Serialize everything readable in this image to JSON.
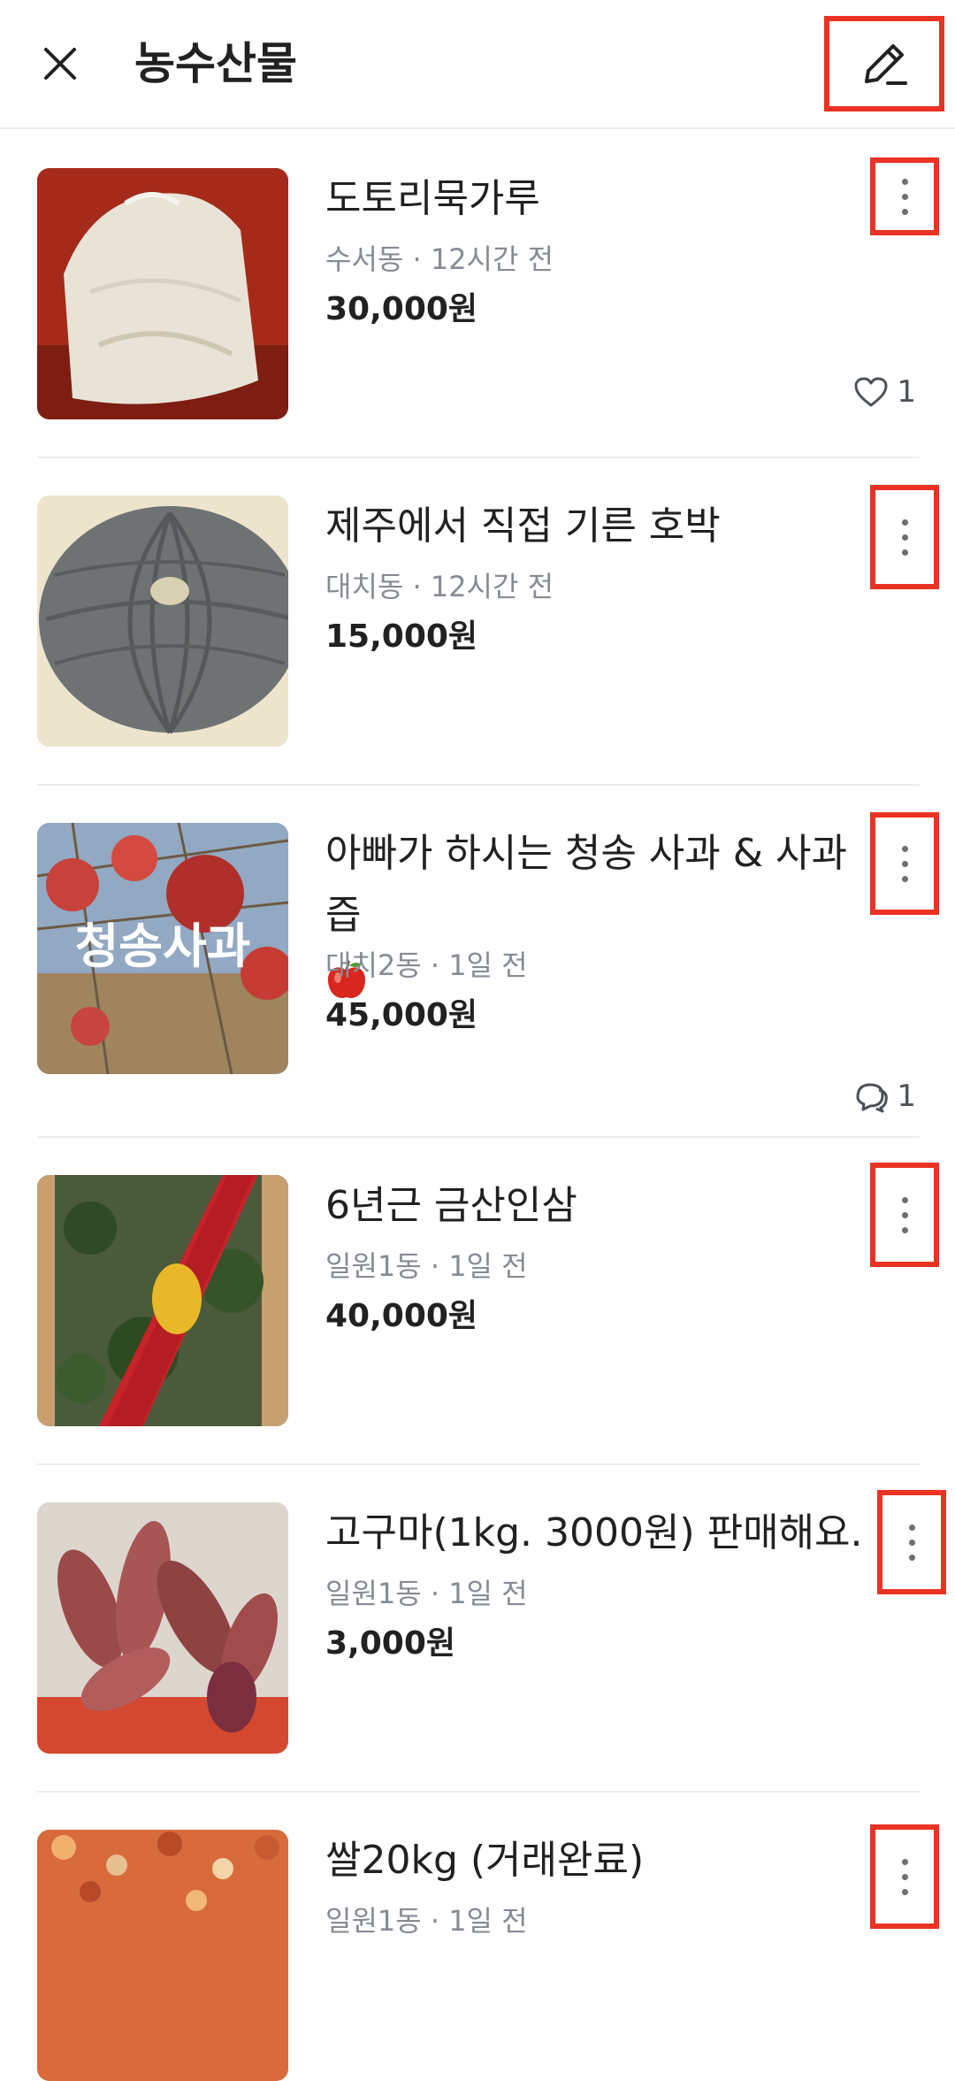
{
  "header": {
    "title": "농수산물",
    "close_icon": "close-icon",
    "edit_icon": "pencil-icon"
  },
  "items": [
    {
      "title": "도토리묵가루",
      "meta": "수서동 · 12시간 전",
      "price": "30,000원",
      "stat": {
        "icon": "heart-icon",
        "count": "1"
      }
    },
    {
      "title": "제주에서 직접 기른 호박",
      "meta": "대치동 · 12시간 전",
      "price": "15,000원"
    },
    {
      "title": "아빠가 하시는 청송 사과 & 사과즙",
      "title_emoji": "apple-emoji",
      "thumb_text": "청송사과",
      "meta": "대치2동 · 1일 전",
      "price": "45,000원",
      "stat": {
        "icon": "chat-bubble-icon",
        "count": "1"
      }
    },
    {
      "title": "6년근 금산인삼",
      "meta": "일원1동 · 1일 전",
      "price": "40,000원"
    },
    {
      "title": "고구마(1kg. 3000원) 판매해요.",
      "meta": "일원1동 · 1일 전",
      "price": "3,000원"
    },
    {
      "title": "쌀20kg (거래완료)",
      "meta": "일원1동 · 1일 전",
      "price": ""
    }
  ],
  "colors": {
    "highlight_box": "#ea3323",
    "meta_text": "#868b94",
    "divider": "#ececec"
  }
}
